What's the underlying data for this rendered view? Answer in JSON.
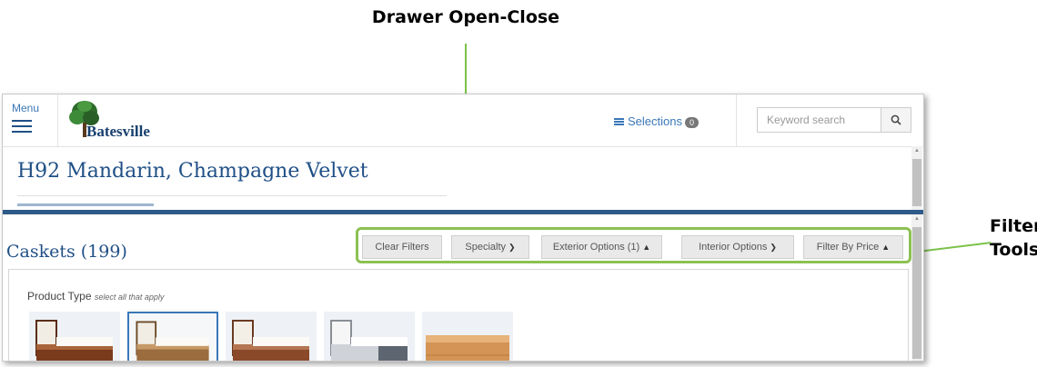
{
  "annotations": {
    "drawer": "Drawer Open-Close",
    "filter_line1": "Filter",
    "filter_line2": "Tools",
    "accent_color": "#8cc152"
  },
  "header": {
    "menu_label": "Menu",
    "logo_text": "Batesville",
    "selections_label": "Selections",
    "selections_count": "0",
    "search_placeholder": "Keyword search"
  },
  "product": {
    "title": "H92 Mandarin, Champagne Velvet"
  },
  "catalog": {
    "heading": "Caskets (199)",
    "filters": [
      {
        "label": "Clear Filters",
        "chevron": ""
      },
      {
        "label": "Specialty",
        "chevron": "down"
      },
      {
        "label": "Exterior Options (1)",
        "chevron": "up"
      },
      {
        "label": "Interior Options",
        "chevron": "down"
      },
      {
        "label": "Filter By Price",
        "chevron": "up"
      }
    ],
    "product_type_label": "Product Type",
    "product_type_hint": "select all that apply",
    "product_types": [
      {
        "name": "mahogany-casket",
        "selected": false
      },
      {
        "name": "copper-casket",
        "selected": true
      },
      {
        "name": "cherry-casket",
        "selected": false
      },
      {
        "name": "silver-casket",
        "selected": false
      },
      {
        "name": "wood-cremation-container",
        "selected": false
      }
    ]
  },
  "colors": {
    "brand_blue": "#1f4f86",
    "link_blue": "#3a77b8",
    "drawer_blue": "#2e5a8a"
  }
}
